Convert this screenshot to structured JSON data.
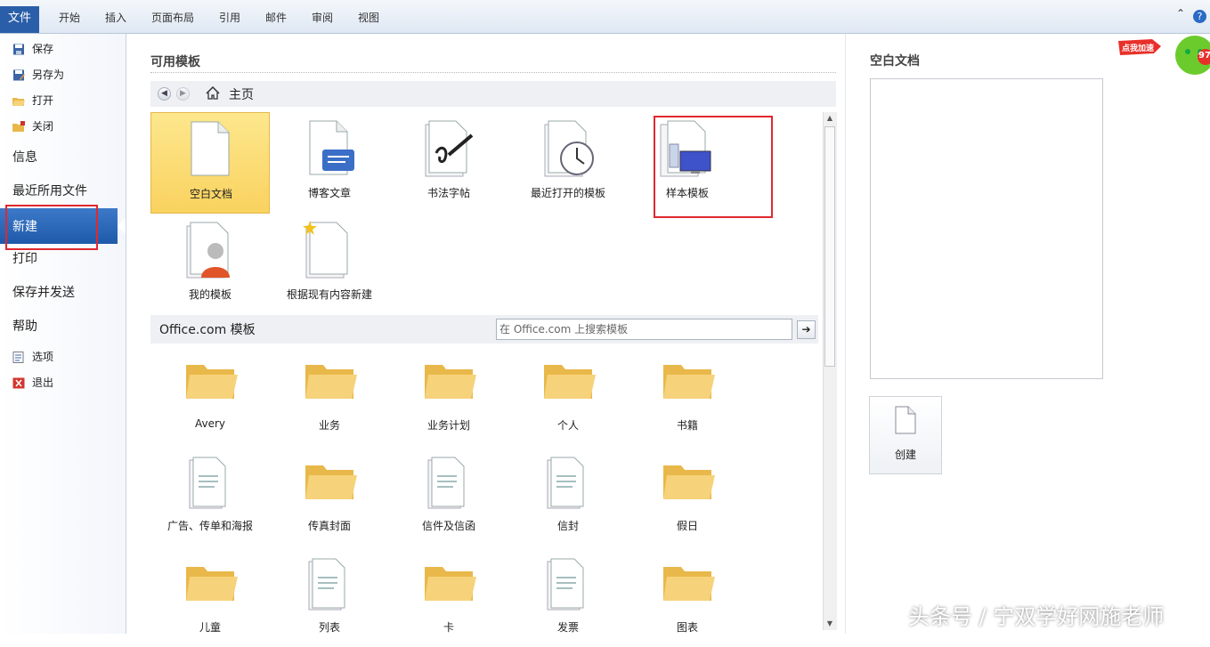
{
  "ribbon": {
    "file_tab": "文件",
    "tabs": [
      "开始",
      "插入",
      "页面布局",
      "引用",
      "邮件",
      "审阅",
      "视图"
    ],
    "help": "?",
    "minimize": "⌃"
  },
  "nav": {
    "save": "保存",
    "save_as": "另存为",
    "open": "打开",
    "close": "关闭",
    "info": "信息",
    "recent": "最近所用文件",
    "new": "新建",
    "print": "打印",
    "save_send": "保存并发送",
    "help": "帮助",
    "options": "选项",
    "exit": "退出"
  },
  "available": {
    "title": "可用模板",
    "home": "主页",
    "templates": [
      {
        "label": "空白文档",
        "icon": "blank-document-icon",
        "selected": true
      },
      {
        "label": "博客文章",
        "icon": "blog-post-icon"
      },
      {
        "label": "书法字帖",
        "icon": "calligraphy-icon"
      },
      {
        "label": "最近打开的模板",
        "icon": "recent-template-clock-icon"
      },
      {
        "label": "样本模板",
        "icon": "sample-template-icon"
      },
      {
        "label": "我的模板",
        "icon": "my-template-user-icon"
      },
      {
        "label": "根据现有内容新建",
        "icon": "new-from-existing-icon"
      }
    ]
  },
  "office": {
    "title": "Office.com 模板",
    "search_placeholder": "在 Office.com 上搜索模板",
    "go": "➔",
    "items": [
      {
        "label": "Avery",
        "icon": "folder-icon"
      },
      {
        "label": "业务",
        "icon": "folder-icon"
      },
      {
        "label": "业务计划",
        "icon": "folder-icon"
      },
      {
        "label": "个人",
        "icon": "folder-icon"
      },
      {
        "label": "书籍",
        "icon": "folder-icon"
      },
      {
        "label": "广告、传单和海报",
        "icon": "flyer-document-icon"
      },
      {
        "label": "传真封面",
        "icon": "folder-icon"
      },
      {
        "label": "信件及信函",
        "icon": "letter-pen-icon"
      },
      {
        "label": "信封",
        "icon": "envelope-document-icon"
      },
      {
        "label": "假日",
        "icon": "folder-icon"
      },
      {
        "label": "儿童",
        "icon": "folder-icon"
      },
      {
        "label": "列表",
        "icon": "checklist-document-icon"
      },
      {
        "label": "卡",
        "icon": "folder-icon"
      },
      {
        "label": "发票",
        "icon": "invoice-document-icon"
      },
      {
        "label": "图表",
        "icon": "folder-icon"
      }
    ]
  },
  "preview": {
    "title": "空白文档",
    "create": "创建"
  },
  "badge": {
    "text": "点我加速",
    "number": "97"
  },
  "watermark": "头条号 / 宁双学好网施老师",
  "colors": {
    "accent": "#2a5ea8",
    "highlight_box": "#e0282e",
    "selected_tile": "#f9d25f",
    "folder": "#f3c652"
  }
}
